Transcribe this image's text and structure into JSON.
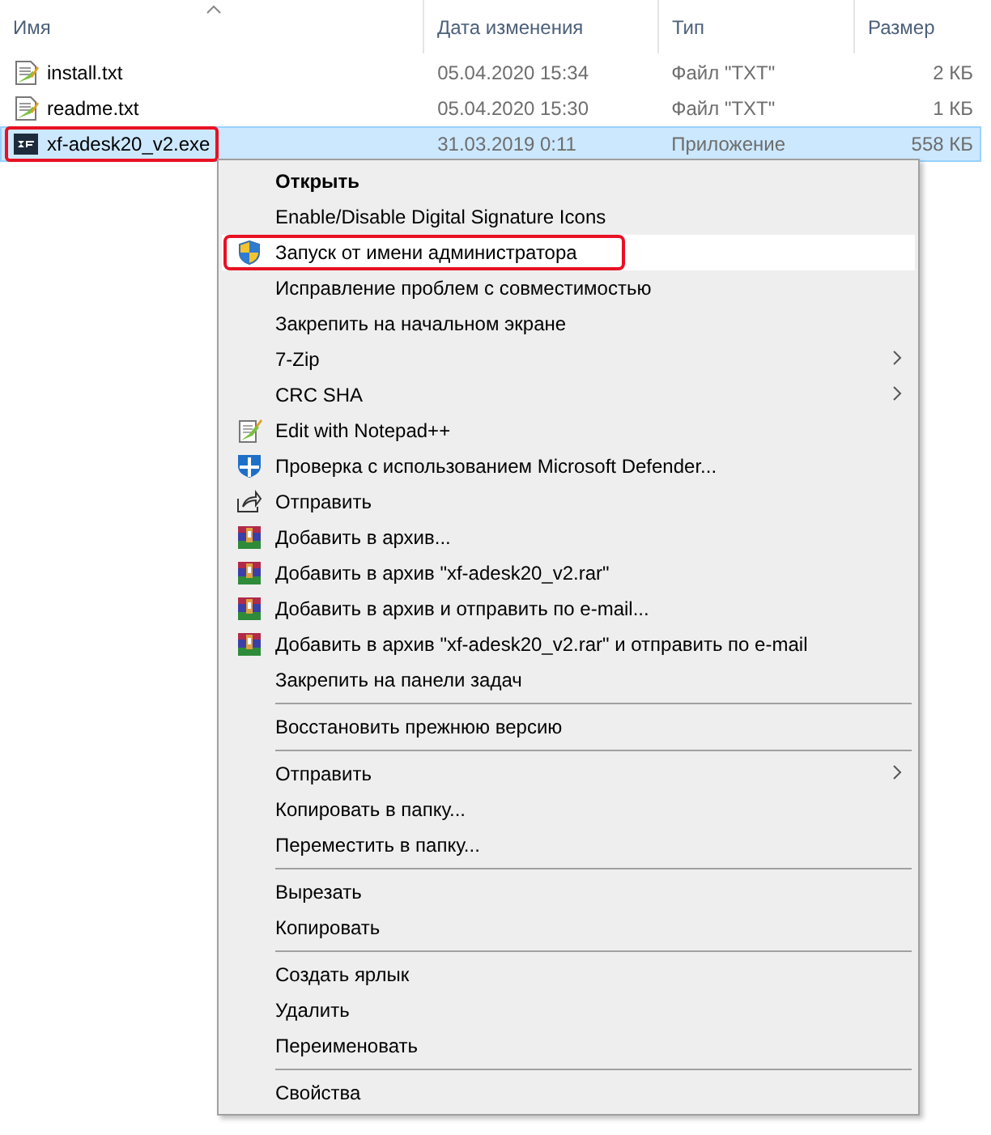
{
  "columns": [
    {
      "label": "Имя",
      "sorted": true
    },
    {
      "label": "Дата изменения",
      "sorted": false
    },
    {
      "label": "Тип",
      "sorted": false
    },
    {
      "label": "Размер",
      "sorted": false
    }
  ],
  "files": [
    {
      "name": "install.txt",
      "date": "05.04.2020 15:34",
      "type": "Файл \"TXT\"",
      "size": "2 КБ",
      "kind": "text",
      "selected": false,
      "outlined": false
    },
    {
      "name": "readme.txt",
      "date": "05.04.2020 15:30",
      "type": "Файл \"TXT\"",
      "size": "1 КБ",
      "kind": "text",
      "selected": false,
      "outlined": false
    },
    {
      "name": "xf-adesk20_v2.exe",
      "date": "31.03.2019 0:11",
      "type": "Приложение",
      "size": "558 КБ",
      "kind": "app",
      "selected": true,
      "outlined": true
    }
  ],
  "menu": [
    {
      "kind": "item",
      "label": "Открыть",
      "bold": true,
      "hovered": false,
      "outlined": false,
      "submenu": false
    },
    {
      "kind": "item",
      "label": "Enable/Disable Digital Signature Icons",
      "bold": false,
      "hovered": false,
      "outlined": false,
      "submenu": false
    },
    {
      "kind": "shield",
      "label": "Запуск от имени администратора",
      "bold": false,
      "hovered": true,
      "outlined": true,
      "submenu": false
    },
    {
      "kind": "item",
      "label": "Исправление проблем с совместимостью",
      "bold": false,
      "hovered": false,
      "outlined": false,
      "submenu": false
    },
    {
      "kind": "item",
      "label": "Закрепить на начальном экране",
      "bold": false,
      "hovered": false,
      "outlined": false,
      "submenu": false
    },
    {
      "kind": "item",
      "label": "7-Zip",
      "bold": false,
      "hovered": false,
      "outlined": false,
      "submenu": true
    },
    {
      "kind": "item",
      "label": "CRC SHA",
      "bold": false,
      "hovered": false,
      "outlined": false,
      "submenu": true
    },
    {
      "kind": "notepad",
      "label": "Edit with Notepad++",
      "bold": false,
      "hovered": false,
      "outlined": false,
      "submenu": false
    },
    {
      "kind": "defender",
      "label": "Проверка с использованием Microsoft Defender...",
      "bold": false,
      "hovered": false,
      "outlined": false,
      "submenu": false
    },
    {
      "kind": "share",
      "label": "Отправить",
      "bold": false,
      "hovered": false,
      "outlined": false,
      "submenu": false
    },
    {
      "kind": "archive",
      "label": "Добавить в архив...",
      "bold": false,
      "hovered": false,
      "outlined": false,
      "submenu": false
    },
    {
      "kind": "archive",
      "label": "Добавить в архив \"xf-adesk20_v2.rar\"",
      "bold": false,
      "hovered": false,
      "outlined": false,
      "submenu": false
    },
    {
      "kind": "archive",
      "label": "Добавить в архив и отправить по e-mail...",
      "bold": false,
      "hovered": false,
      "outlined": false,
      "submenu": false
    },
    {
      "kind": "archive",
      "label": "Добавить в архив \"xf-adesk20_v2.rar\" и отправить по e-mail",
      "bold": false,
      "hovered": false,
      "outlined": false,
      "submenu": false
    },
    {
      "kind": "item",
      "label": "Закрепить на панели задач",
      "bold": false,
      "hovered": false,
      "outlined": false,
      "submenu": false
    },
    {
      "kind": "separator"
    },
    {
      "kind": "item",
      "label": "Восстановить прежнюю версию",
      "bold": false,
      "hovered": false,
      "outlined": false,
      "submenu": false
    },
    {
      "kind": "separator"
    },
    {
      "kind": "item",
      "label": "Отправить",
      "bold": false,
      "hovered": false,
      "outlined": false,
      "submenu": true
    },
    {
      "kind": "item",
      "label": "Копировать в папку...",
      "bold": false,
      "hovered": false,
      "outlined": false,
      "submenu": false
    },
    {
      "kind": "item",
      "label": "Переместить в папку...",
      "bold": false,
      "hovered": false,
      "outlined": false,
      "submenu": false
    },
    {
      "kind": "separator"
    },
    {
      "kind": "item",
      "label": "Вырезать",
      "bold": false,
      "hovered": false,
      "outlined": false,
      "submenu": false
    },
    {
      "kind": "item",
      "label": "Копировать",
      "bold": false,
      "hovered": false,
      "outlined": false,
      "submenu": false
    },
    {
      "kind": "separator"
    },
    {
      "kind": "item",
      "label": "Создать ярлык",
      "bold": false,
      "hovered": false,
      "outlined": false,
      "submenu": false
    },
    {
      "kind": "item",
      "label": "Удалить",
      "bold": false,
      "hovered": false,
      "outlined": false,
      "submenu": false
    },
    {
      "kind": "item",
      "label": "Переименовать",
      "bold": false,
      "hovered": false,
      "outlined": false,
      "submenu": false
    },
    {
      "kind": "separator"
    },
    {
      "kind": "item",
      "label": "Свойства",
      "bold": false,
      "hovered": false,
      "outlined": false,
      "submenu": false
    }
  ]
}
